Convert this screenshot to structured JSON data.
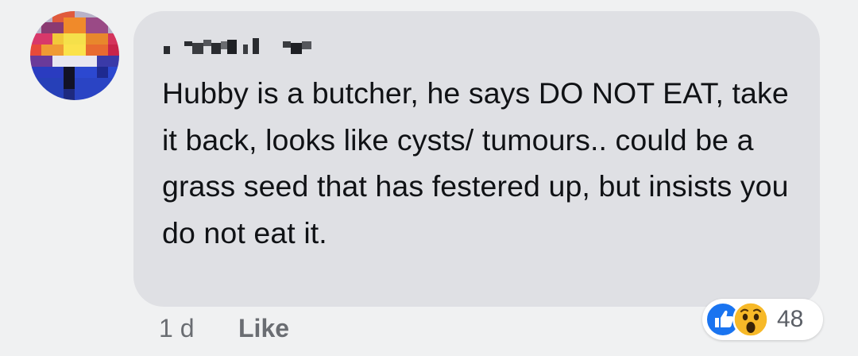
{
  "comment": {
    "text": "Hubby is a butcher, he says DO NOT EAT, take it back, looks like cysts/ tumours.. could be a grass seed that has festered up, but insists you do not eat it."
  },
  "reactions": {
    "icons": [
      "like-icon",
      "wow-icon"
    ],
    "count": "48",
    "colors": {
      "like": "#1877f2",
      "wow": "#f7b928"
    }
  },
  "footer": {
    "timestamp": "1 d",
    "like_label": "Like"
  }
}
